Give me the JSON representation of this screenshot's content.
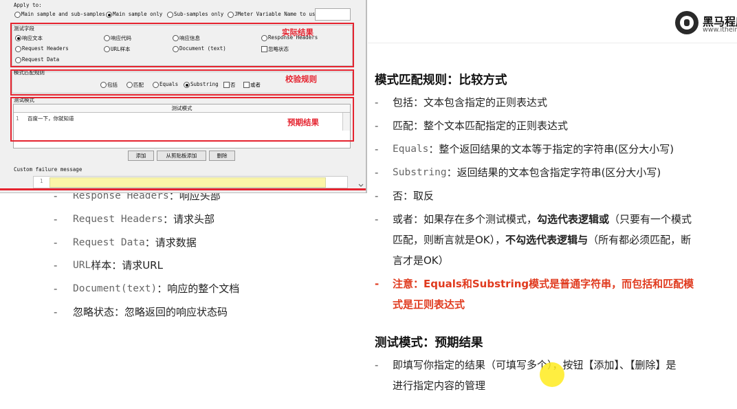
{
  "dialog": {
    "apply_to_label": "Apply to:",
    "apply_options": [
      "Main sample and sub-samples",
      "Main sample only",
      "Sub-samples only",
      "JMeter Variable Name to use"
    ],
    "apply_selected": 1,
    "field_section_title": "测试字段",
    "field_options": [
      "响应文本",
      "响应代码",
      "响应信息",
      "Response Headers",
      "Request Headers",
      "URL样本",
      "Document (text)",
      "Request Data"
    ],
    "ignore_status_label": "忽略状态",
    "field_annotation": "实际结果",
    "rule_section_title": "模式匹配规则",
    "rule_options": [
      "包括",
      "匹配",
      "Equals",
      "Substring"
    ],
    "rule_selected": 3,
    "rule_checks": [
      "否",
      "或者"
    ],
    "rule_annotation": "校验规则",
    "pattern_section_title": "测试模式",
    "pattern_table_header": "测试模式",
    "pattern_row_index": "1",
    "pattern_row_value": "百度一下，你就知道",
    "pattern_annotation": "预期结果",
    "buttons": [
      "添加",
      "从剪贴板添加",
      "删除"
    ],
    "custom_failure_label": "Custom failure message",
    "custom_failure_line": "1"
  },
  "left_list": [
    {
      "mono": "Response Headers",
      "text": "：响应头部"
    },
    {
      "mono": "Request Headers",
      "text": "：请求头部"
    },
    {
      "mono": "Request Data",
      "text": "：请求数据"
    },
    {
      "mono": "URL",
      "text": "样本：请求URL"
    },
    {
      "mono": "Document(text)",
      "text": "：响应的整个文档"
    },
    {
      "mono": "",
      "text": "忽略状态：忽略返回的响应状态码"
    }
  ],
  "logo": {
    "name": "黑马程序",
    "url": "www.itheima"
  },
  "section1": {
    "heading": "模式匹配规则：比较方式",
    "items": [
      {
        "pre": "包括：文本包含指定的正则表达式"
      },
      {
        "pre": "匹配：整个文本匹配指定的正则表达式"
      },
      {
        "mono": "Equals",
        "post": "：整个返回结果的文本等于指定的字符串(区分大小写)"
      },
      {
        "mono": "Substring",
        "post": "：返回结果的文本包含指定字符串(区分大小写)"
      },
      {
        "pre": "否：取反"
      }
    ],
    "or_line1_a": "或者：如果存在多个测试模式，",
    "or_line1_b": "勾选代表逻辑或",
    "or_line1_c": "（只要有一个模式",
    "or_line2_a": "匹配，则断言就是OK），",
    "or_line2_b": "不勾选代表逻辑与",
    "or_line2_c": "（所有都必须匹配，断",
    "or_line3": "言才是OK）",
    "note_line1": "注意：Equals和Substring模式是普通字符串，而包括和匹配模",
    "note_line2": "式是正则表达式"
  },
  "section2": {
    "heading": "测试模式：预期结果",
    "line1": "即填写你指定的结果（可填写多个），按钮【添加】、【删除】是",
    "line2": "进行指定内容的管理"
  },
  "colors": {
    "annotation_red": "#e5232f",
    "note_red": "#e03a1e",
    "cursor_yellow": "#ffeb1e"
  }
}
